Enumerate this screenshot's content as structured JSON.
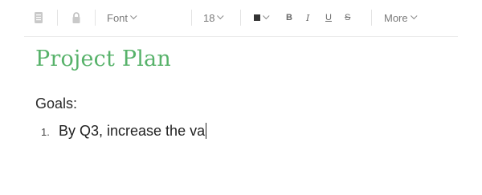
{
  "toolbar": {
    "font_label": "Font",
    "size_label": "18",
    "bold": "B",
    "italic": "I",
    "underline": "U",
    "strike": "S",
    "more_label": "More"
  },
  "document": {
    "title": "Project Plan",
    "heading": "Goals:",
    "list": [
      {
        "number": "1.",
        "text": "By Q3, increase the va"
      }
    ]
  },
  "colors": {
    "title": "#57b26a",
    "toolbar_text": "#7a7a7a"
  }
}
